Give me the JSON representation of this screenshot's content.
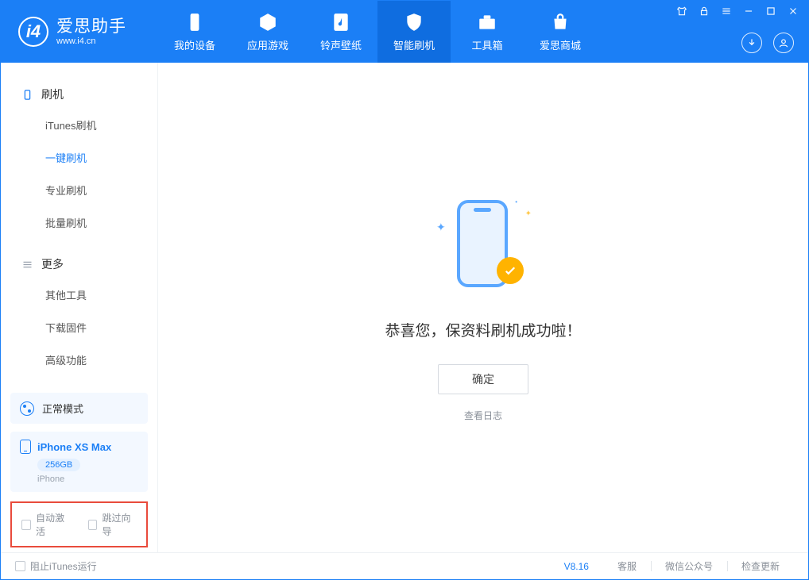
{
  "header": {
    "app_name": "爱思助手",
    "app_domain": "www.i4.cn",
    "tabs": [
      {
        "label": "我的设备"
      },
      {
        "label": "应用游戏"
      },
      {
        "label": "铃声壁纸"
      },
      {
        "label": "智能刷机"
      },
      {
        "label": "工具箱"
      },
      {
        "label": "爱思商城"
      }
    ]
  },
  "sidebar": {
    "groups": [
      {
        "title": "刷机",
        "items": [
          "iTunes刷机",
          "一键刷机",
          "专业刷机",
          "批量刷机"
        ]
      },
      {
        "title": "更多",
        "items": [
          "其他工具",
          "下载固件",
          "高级功能"
        ]
      }
    ],
    "mode_label": "正常模式",
    "device_name": "iPhone XS Max",
    "device_capacity": "256GB",
    "device_type": "iPhone",
    "opt_auto_activate": "自动激活",
    "opt_skip_guide": "跳过向导"
  },
  "main": {
    "success_message": "恭喜您，保资料刷机成功啦！",
    "ok_button": "确定",
    "view_log": "查看日志"
  },
  "footer": {
    "block_itunes": "阻止iTunes运行",
    "version": "V8.16",
    "links": [
      "客服",
      "微信公众号",
      "检查更新"
    ]
  }
}
